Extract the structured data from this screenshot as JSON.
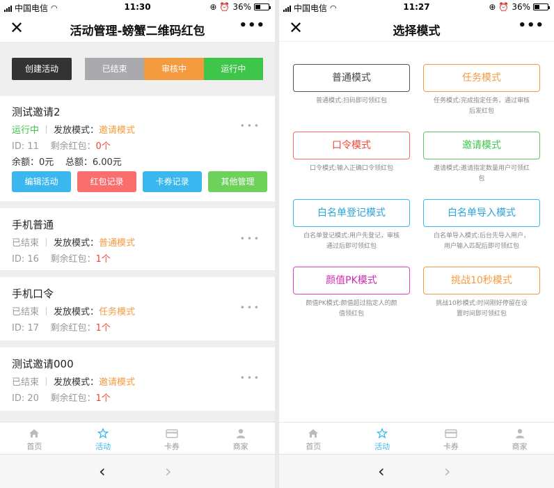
{
  "status_bar": {
    "carrier": "中国电信",
    "battery": "36%"
  },
  "left": {
    "time": "11:30",
    "title": "活动管理-螃蟹二维码红包",
    "create_button": "创建活动",
    "filters": [
      "已结束",
      "审核中",
      "运行中"
    ],
    "activities": [
      {
        "name": "测试邀请2",
        "status": "运行中",
        "mode_label": "发放模式：",
        "mode": "邀请模式",
        "id_text": "ID: 11",
        "remaining_label": "剩余红包：",
        "remaining": "0个",
        "balance": "余额：0元",
        "total": "总额：6.00元",
        "actions": [
          "编辑活动",
          "红包记录",
          "卡券记录",
          "其他管理"
        ]
      },
      {
        "name": "手机普通",
        "status": "已结束",
        "mode_label": "发放模式：",
        "mode": "普通模式",
        "id_text": "ID: 16",
        "remaining_label": "剩余红包：",
        "remaining": "1个"
      },
      {
        "name": "手机口令",
        "status": "已结束",
        "mode_label": "发放模式：",
        "mode": "任务模式",
        "id_text": "ID: 17",
        "remaining_label": "剩余红包：",
        "remaining": "1个"
      },
      {
        "name": "测试邀请000",
        "status": "已结束",
        "mode_label": "发放模式：",
        "mode": "邀请模式",
        "id_text": "ID: 20",
        "remaining_label": "剩余红包：",
        "remaining": "1个"
      }
    ]
  },
  "right": {
    "time": "11:27",
    "title": "选择模式",
    "modes": [
      {
        "label": "普通模式",
        "desc": "普通模式:扫码即可领红包"
      },
      {
        "label": "任务模式",
        "desc": "任务模式:完成指定任务，通过审核后发红包"
      },
      {
        "label": "口令模式",
        "desc": "口令模式:输入正确口令领红包"
      },
      {
        "label": "邀请模式",
        "desc": "邀请模式:邀请指定数量用户可领红包"
      },
      {
        "label": "白名单登记模式",
        "desc": "白名单登记模式:用户先登记，审核通过后即可领红包"
      },
      {
        "label": "白名单导入模式",
        "desc": "白名单导入模式:后台先导入用户，用户输入匹配后即可领红包"
      },
      {
        "label": "颜值PK模式",
        "desc": "颜值PK模式:颜值超过指定人的颜值领红包"
      },
      {
        "label": "挑战10秒模式",
        "desc": "挑战10秒模式:时间刚好停留在设置时间即可领红包"
      }
    ]
  },
  "tabbar": [
    {
      "label": "首页",
      "icon": "home-icon"
    },
    {
      "label": "活动",
      "icon": "star-icon",
      "active": true
    },
    {
      "label": "卡券",
      "icon": "card-icon"
    },
    {
      "label": "商家",
      "icon": "user-icon"
    }
  ],
  "browser": {
    "back": "‹",
    "forward": "›"
  },
  "colors": {
    "running": "#3dc64a",
    "pending": "#f59b3f",
    "ended": "#a9a9ae",
    "accent": "#3ab7ee",
    "danger": "#f44336"
  }
}
